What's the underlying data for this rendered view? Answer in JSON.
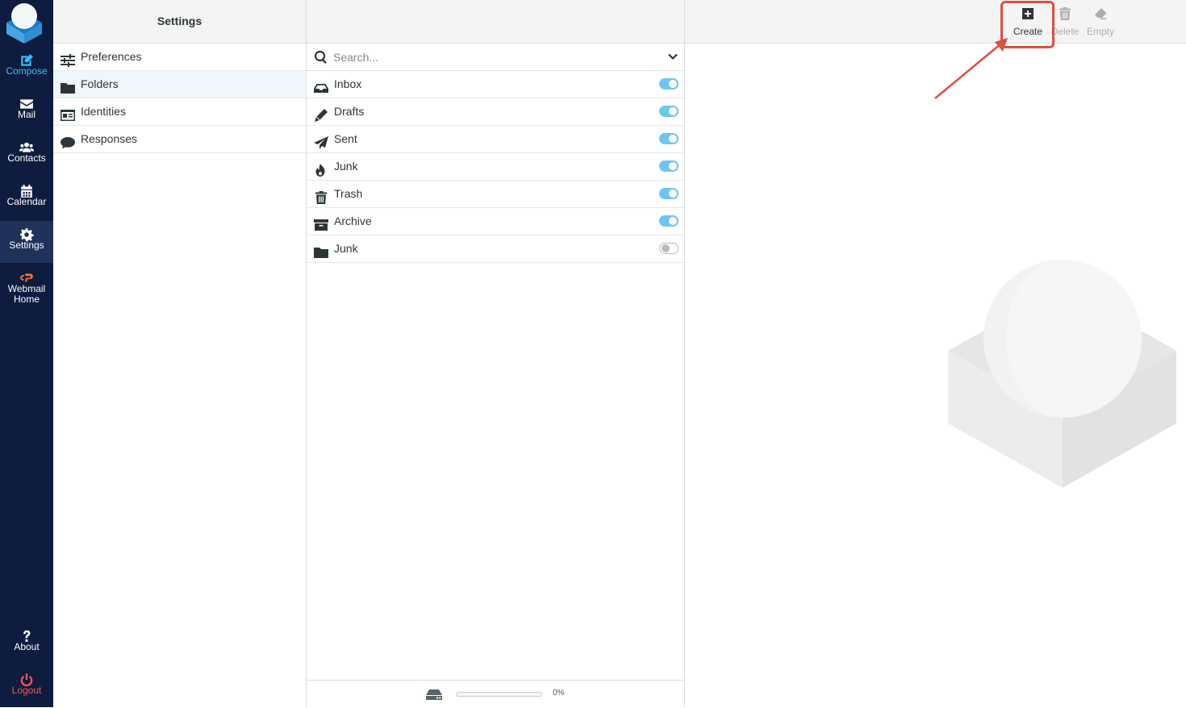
{
  "nav": {
    "compose": "Compose",
    "mail": "Mail",
    "contacts": "Contacts",
    "calendar": "Calendar",
    "settings": "Settings",
    "webmail_home": "Webmail Home",
    "about": "About",
    "logout": "Logout"
  },
  "sidebar": {
    "title": "Settings",
    "items": [
      {
        "label": "Preferences",
        "icon": "sliders-icon"
      },
      {
        "label": "Folders",
        "icon": "folder-icon",
        "selected": true
      },
      {
        "label": "Identities",
        "icon": "id-card-icon"
      },
      {
        "label": "Responses",
        "icon": "comment-icon"
      }
    ]
  },
  "folders": {
    "search_placeholder": "Search...",
    "items": [
      {
        "label": "Inbox",
        "icon": "inbox-icon",
        "subscribed": true
      },
      {
        "label": "Drafts",
        "icon": "pencil-icon",
        "subscribed": true
      },
      {
        "label": "Sent",
        "icon": "paper-plane-icon",
        "subscribed": true
      },
      {
        "label": "Junk",
        "icon": "fire-icon",
        "subscribed": true
      },
      {
        "label": "Trash",
        "icon": "trash-icon",
        "subscribed": true
      },
      {
        "label": "Archive",
        "icon": "archive-icon",
        "subscribed": true
      },
      {
        "label": "Junk",
        "icon": "folder-icon",
        "subscribed": false
      }
    ],
    "quota_percent": "0%",
    "quota_fill": 0
  },
  "toolbar": {
    "create": "Create",
    "delete": "Delete",
    "empty": "Empty"
  },
  "colors": {
    "nav_bg": "#0e1c3f",
    "accent": "#37beff",
    "toggle_on": "#6bc7f2",
    "highlight": "#e04f41",
    "logout": "#ff5552"
  }
}
